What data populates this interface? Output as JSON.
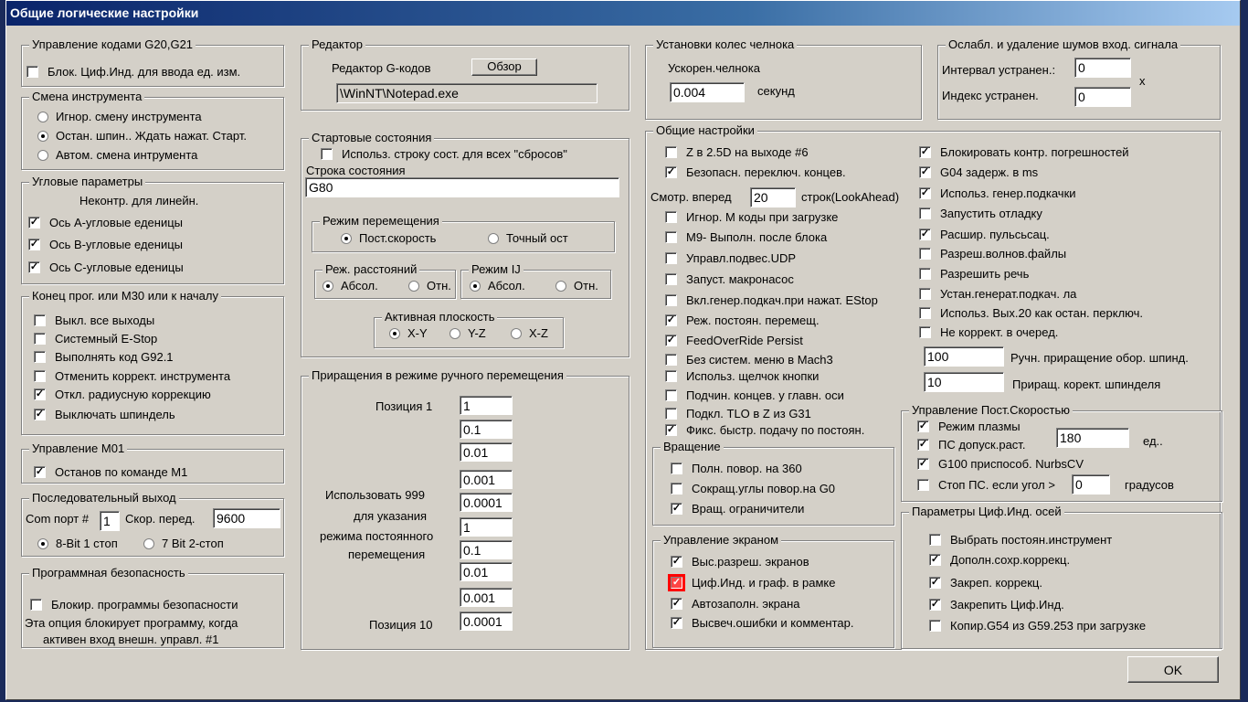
{
  "title": "Общие логические настройки",
  "g2021": {
    "label": "Управление кодами G20,G21",
    "cb": {
      "label": "Блок. Циф.Инд. для ввода ед. изм.",
      "checked": false
    }
  },
  "tool": {
    "label": "Смена инструмента",
    "options": [
      "Игнор. смену инструмента",
      "Остан. шпин.. Ждать нажат. Старт.",
      "Автом. смена интрумента"
    ],
    "selected": 1
  },
  "angular": {
    "label": "Угловые параметры",
    "note": "Неконтр. для линейн.",
    "items": [
      {
        "label": "Ось А-угловые еденицы",
        "checked": true
      },
      {
        "label": "Ось В-угловые еденицы",
        "checked": true
      },
      {
        "label": "Ось С-угловые еденицы",
        "checked": true
      }
    ]
  },
  "endprog": {
    "label": "Конец прог. или М30 или к началу",
    "items": [
      {
        "label": "Выкл. все выходы",
        "checked": false
      },
      {
        "label": "Системный E-Stop",
        "checked": false
      },
      {
        "label": "Выполнять код  G92.1",
        "checked": false
      },
      {
        "label": "Отменить коррект. инструмента",
        "checked": false
      },
      {
        "label": "Откл. радиусную коррекцию",
        "checked": true
      },
      {
        "label": "Выключать шпиндель",
        "checked": true
      }
    ]
  },
  "m01": {
    "label": "Управление М01",
    "cb": {
      "label": "Останов по команде М1",
      "checked": true
    }
  },
  "serial": {
    "label": "Последовательный выход",
    "com_label": "Com порт #",
    "com": "1",
    "speed_label": "Скор. перед.",
    "speed": "9600",
    "options": [
      "8-Bit 1 стоп",
      "7 Bit 2-стоп"
    ],
    "selected": 0
  },
  "security": {
    "label": "Программная безопасность",
    "cb": {
      "label": "Блокир. программы безопасности",
      "checked": false
    },
    "note1": "Эта опция блокирует программу, когда",
    "note2": "активен вход внешн. управл. #1"
  },
  "editor": {
    "label": "Редактор",
    "gcode_label": "Редактор G-кодов",
    "browse": "Обзор",
    "path": "\\WinNT\\Notepad.exe"
  },
  "startup": {
    "label": "Стартовые состояния",
    "cb": {
      "label": "Использ. строку сост. для всех \"сбросов\"",
      "checked": false
    },
    "status_label": "Строка состояния",
    "status": "G80",
    "motion": {
      "label": "Режим перемещения",
      "options": [
        "Пост.скорость",
        "Точный ост"
      ],
      "selected": 0
    },
    "distance": {
      "label": "Реж. расстояний",
      "options": [
        "Абсол.",
        "Отн."
      ],
      "selected": 0
    },
    "ij": {
      "label": "Режим IJ",
      "options": [
        "Абсол.",
        "Отн."
      ],
      "selected": 0
    },
    "plane": {
      "label": "Активная плоскость",
      "options": [
        "X-Y",
        "Y-Z",
        "X-Z"
      ],
      "selected": 0
    }
  },
  "jog": {
    "label": "Приращения в режиме ручного перемещения",
    "pos1": "Позиция 1",
    "pos10": "Позиция 10",
    "note": [
      "Использовать 999",
      "для указания",
      "режима постоянного",
      "перемещения"
    ],
    "values": [
      "1",
      "0.1",
      "0.01",
      "0.001",
      "0.0001",
      "1",
      "0.1",
      "0.01",
      "0.001",
      "0.0001"
    ]
  },
  "shuttle": {
    "label": "Установки колес челнока",
    "accel_label": "Ускорен.челнока",
    "accel": "0.004",
    "unit": "секунд"
  },
  "debounce": {
    "label": "Ослабл. и удаление шумов вход. сигнала",
    "interval_label": "Интервал устранен.:",
    "interval": "0",
    "index_label": "Индекс устранен.",
    "index": "0",
    "x": "x"
  },
  "general": {
    "label": "Общие настройки",
    "left": [
      {
        "label": "Z в 2.5D на выходе #6",
        "checked": false
      },
      {
        "label": "Безопасн. переключ. концев.",
        "checked": true
      },
      {
        "label": "Игнор. М коды при загрузке",
        "checked": false
      },
      {
        "label": "М9- Выполн. после блока",
        "checked": false
      },
      {
        "label": "Управл.подвес.UDP",
        "checked": false
      },
      {
        "label": "Запуст. макронасос",
        "checked": false
      },
      {
        "label": "Вкл.генер.подкач.при нажат. EStop",
        "checked": false
      },
      {
        "label": "Реж. постоян. перемещ.",
        "checked": true
      },
      {
        "label": "FeedOverRide Persist",
        "checked": true
      },
      {
        "label": "Без систем. меню в Mach3",
        "checked": false
      },
      {
        "label": "Использ. щелчок кнопки",
        "checked": false
      },
      {
        "label": "Подчин. концев. у главн. оси",
        "checked": false
      },
      {
        "label": "Подкл. TLO в Z из G31",
        "checked": false
      },
      {
        "label": "Фикс. быстр. подачу по постоян.",
        "checked": true
      }
    ],
    "lookahead_label": "Смотр. вперед",
    "lookahead": "20",
    "lookahead_unit": "строк(LookAhead)",
    "right": [
      {
        "label": "Блокировать контр. погрешностей",
        "checked": true
      },
      {
        "label": "G04 задерж. в ms",
        "checked": true
      },
      {
        "label": "Использ. генер.подкачки",
        "checked": true
      },
      {
        "label": "Запустить отладку",
        "checked": false
      },
      {
        "label": "Расшир. пульсьсац.",
        "checked": true
      },
      {
        "label": "Разреш.волнов.файлы",
        "checked": false
      },
      {
        "label": "Разрешить речь",
        "checked": false
      },
      {
        "label": "Устан.генерат.подкач. ла",
        "checked": false
      },
      {
        "label": "Использ. Вых.20 как остан. перключ.",
        "checked": false
      },
      {
        "label": "Не коррект. в очеред.",
        "checked": false
      }
    ],
    "spindle_inc": "100",
    "spindle_inc_label": "Ручн. приращение обор. шпинд.",
    "spindle_ovr": "10",
    "spindle_ovr_label": "Приращ. корект. шпинделя"
  },
  "rotation": {
    "label": "Вращение",
    "items": [
      {
        "label": "Полн. повор. на 360",
        "checked": false
      },
      {
        "label": "Сокращ.углы повор.на G0",
        "checked": false
      },
      {
        "label": "Вращ. ограничители",
        "checked": true
      }
    ]
  },
  "screen": {
    "label": "Управление экраном",
    "items": [
      {
        "label": "Выс.разреш. экранов",
        "checked": true
      },
      {
        "label": "Циф.Инд. и граф. в рамке",
        "checked": false
      },
      {
        "label": "Автозаполн. экрана",
        "checked": true
      },
      {
        "label": "Высвеч.ошибки и комментар.",
        "checked": true
      }
    ]
  },
  "cv": {
    "label": "Управление Пост.Скоростью",
    "items": [
      {
        "label": "Режим плазмы",
        "checked": true
      },
      {
        "label": "ПС допуск.раст.",
        "checked": true
      },
      {
        "label": "G100 приспособ. NurbsCV",
        "checked": true
      },
      {
        "label": "Стоп ПС. если угол >",
        "checked": false
      }
    ],
    "tol": "180",
    "tol_unit": "ед..",
    "angle": "0",
    "angle_unit": "градусов"
  },
  "dro": {
    "label": "Параметры Циф.Инд. осей",
    "items": [
      {
        "label": "Выбрать постоян.инструмент",
        "checked": false
      },
      {
        "label": "Дополн.сохр.коррекц.",
        "checked": true
      },
      {
        "label": "Закреп. коррекц.",
        "checked": true
      },
      {
        "label": "Закрепить Циф.Инд.",
        "checked": true
      },
      {
        "label": "Копир.G54 из G59.253 при загрузке",
        "checked": false
      }
    ]
  },
  "ok": "OK"
}
